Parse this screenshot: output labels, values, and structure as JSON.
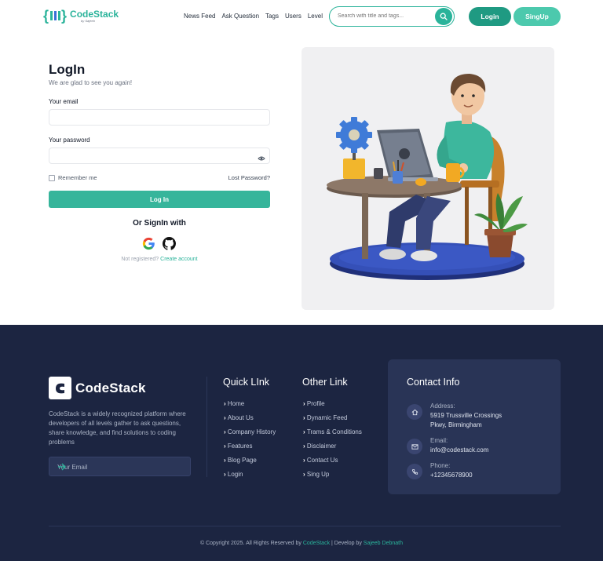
{
  "brand": {
    "name": "CodeStack",
    "byline": "by Sajeeb",
    "color": "#2ab39a"
  },
  "nav": {
    "items": [
      "News Feed",
      "Ask Question",
      "Tags",
      "Users",
      "Level"
    ]
  },
  "search": {
    "placeholder": "Search with title and tags..."
  },
  "header": {
    "login_label": "Login",
    "signup_label": "SingUp"
  },
  "login": {
    "title": "LogIn",
    "subtitle": "We are glad to see you again!",
    "email_label": "Your email",
    "email_value": "",
    "password_label": "Your password",
    "password_value": "",
    "remember_label": "Remember me",
    "lost_password": "Lost Password?",
    "submit_label": "Log In",
    "social_heading": "Or SignIn with",
    "not_registered": "Not registered?",
    "create_account": "Create account"
  },
  "footer": {
    "brand_name": "CodeStack",
    "description": "CodeStack is a widely recognized platform where developers of all levels gather to ask questions, share knowledge, and find solutions to coding problems",
    "email_placeholder": "Your Email",
    "quick_link": {
      "title": "Quick LInk",
      "items": [
        "Home",
        "About Us",
        "Company History",
        "Features",
        "Blog Page",
        "Login"
      ]
    },
    "other_link": {
      "title": "Other Link",
      "items": [
        "Profile",
        "Dynamic Feed",
        "Trams & Conditions",
        "Disclaimer",
        "Contact Us",
        "Sing Up"
      ]
    },
    "contact": {
      "title": "Contact Info",
      "address_label": "Address:",
      "address_line1": "5919 Trussville Crossings",
      "address_line2": "Pkwy, Birmingham",
      "email_label": "Email:",
      "email_value": "info@codestack.com",
      "phone_label": "Phone:",
      "phone_value": "+12345678900"
    },
    "copyright_prefix": "© Copyright 2025. All Rights Reserved by",
    "copyright_brand": "CodeStack",
    "copyright_sep": "| Develop by",
    "copyright_author": "Sajeeb Debnath"
  },
  "colors": {
    "accent": "#2ab39a",
    "footer_bg": "#1c2541",
    "contact_bg": "#293456"
  }
}
